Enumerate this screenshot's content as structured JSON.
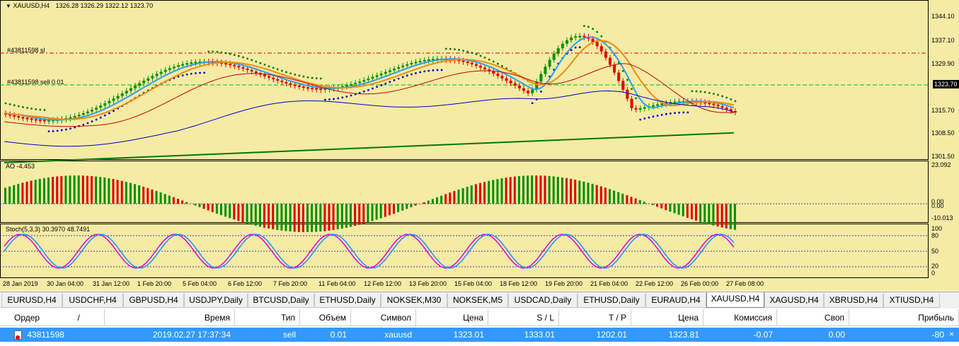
{
  "chart": {
    "symbol_title": "XAUUSD,H4",
    "ohlc": "1326.28 1326.29 1322.12 1323.70",
    "sl_label": "#43811598 sl",
    "order_label": "#43811598 sell 0.01",
    "current_price": "1323.70",
    "price_ticks": [
      "1344.10",
      "1337.10",
      "1329.90",
      "1315.70",
      "1308.50",
      "1301.50"
    ],
    "ao_title": "AO -4.453",
    "ao_ticks": [
      "23.092",
      "0.00",
      "0.00",
      "-10.013"
    ],
    "stoch_title": "Stoch(5,3,3) 30.3970 48.7491",
    "stoch_ticks": [
      "100",
      "80",
      "50",
      "20",
      "0"
    ],
    "time_labels": [
      "28 Jan 2019",
      "30 Jan 04:00",
      "31 Jan 12:00",
      "1 Feb 20:00",
      "5 Feb 04:00",
      "6 Feb 12:00",
      "7 Feb 20:00",
      "11 Feb 04:00",
      "12 Feb 12:00",
      "13 Feb 20:00",
      "15 Feb 04:00",
      "18 Feb 12:00",
      "19 Feb 20:00",
      "21 Feb 04:00",
      "22 Feb 12:00",
      "26 Feb 00:00",
      "27 Feb 08:00"
    ],
    "colors": {
      "background": "#f5eba5",
      "bull_candle": "#009000",
      "bear_candle": "#e00000",
      "ma_fast": "#2ea0f0",
      "ma_mid": "#f08c10",
      "ma_red": "#cc0000",
      "ma_blue": "#0000cc",
      "ma_green": "#007a00",
      "sl_line": "#e00000",
      "entry_line": "#00c000",
      "stoch_main": "#1e90ff",
      "stoch_signal": "#e000e0"
    }
  },
  "tabs": [
    {
      "label": "EURUSD,H4",
      "active": false
    },
    {
      "label": "USDCHF,H4",
      "active": false
    },
    {
      "label": "GBPUSD,H4",
      "active": false
    },
    {
      "label": "USDJPY,Daily",
      "active": false
    },
    {
      "label": "BTCUSD,Daily",
      "active": false
    },
    {
      "label": "ETHUSD,Daily",
      "active": false
    },
    {
      "label": "NOKSEK,M30",
      "active": false
    },
    {
      "label": "NOKSEK,M5",
      "active": false
    },
    {
      "label": "USDCAD,Daily",
      "active": false
    },
    {
      "label": "ETHUSD,Daily",
      "active": false
    },
    {
      "label": "EURAUD,H4",
      "active": false
    },
    {
      "label": "XAUUSD,H4",
      "active": true
    },
    {
      "label": "XAGUSD,H4",
      "active": false
    },
    {
      "label": "XBRUSD,H4",
      "active": false
    },
    {
      "label": "XTIUSD,H4",
      "active": false
    }
  ],
  "orders": {
    "headers": {
      "order": "Ордер",
      "time": "Время",
      "type": "Тип",
      "volume": "Объем",
      "symbol": "Символ",
      "price": "Цена",
      "sl": "S / L",
      "tp": "T / P",
      "cur_price": "Цена",
      "commission": "Комиссия",
      "swap": "Своп",
      "profit": "Прибыль"
    },
    "sort_indicator": "/",
    "rows": [
      {
        "order": "43811598",
        "time": "2019.02.27 17:37:34",
        "type": "sell",
        "volume": "0.01",
        "symbol": "xauusd",
        "price": "1323.01",
        "sl": "1333.01",
        "tp": "1202.01",
        "cur_price": "1323.81",
        "commission": "-0.07",
        "swap": "0.00",
        "profit": "-80"
      }
    ]
  }
}
